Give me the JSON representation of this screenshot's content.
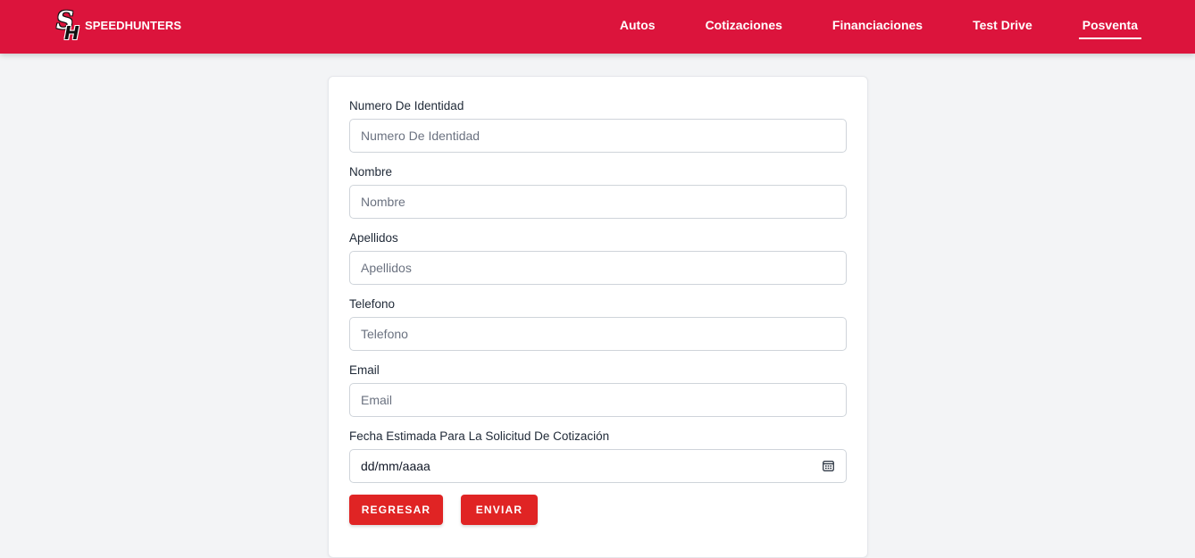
{
  "brand": {
    "name": "SPEEDHUNTERS",
    "logo_letters": "SH"
  },
  "nav": {
    "items": [
      {
        "label": "Autos",
        "active": false
      },
      {
        "label": "Cotizaciones",
        "active": false
      },
      {
        "label": "Financiaciones",
        "active": false
      },
      {
        "label": "Test Drive",
        "active": false
      },
      {
        "label": "Posventa",
        "active": true
      }
    ]
  },
  "form": {
    "fields": [
      {
        "label": "Numero De Identidad",
        "placeholder": "Numero De Identidad",
        "value": ""
      },
      {
        "label": "Nombre",
        "placeholder": "Nombre",
        "value": ""
      },
      {
        "label": "Apellidos",
        "placeholder": "Apellidos",
        "value": ""
      },
      {
        "label": "Telefono",
        "placeholder": "Telefono",
        "value": ""
      },
      {
        "label": "Email",
        "placeholder": "Email",
        "value": ""
      }
    ],
    "date_field": {
      "label": "Fecha Estimada Para La Solicitud De Cotización",
      "value": "dd/mm/aaaa",
      "icon": "calendar-icon"
    },
    "buttons": {
      "back": "REGRESAR",
      "submit": "ENVIAR"
    }
  },
  "colors": {
    "header": "#dc143c",
    "button": "#e02424",
    "background": "#f3f4f6"
  }
}
